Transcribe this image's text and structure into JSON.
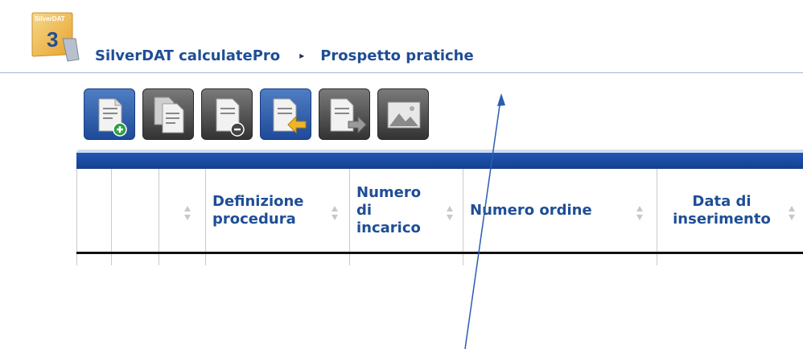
{
  "app": {
    "logo_text": "SilverDAT",
    "logo_number": "3"
  },
  "breadcrumb": {
    "app_name": "SilverDAT calculatePro",
    "separator": "▸",
    "page": "Prospetto pratiche"
  },
  "toolbar": {
    "buttons": [
      {
        "name": "new-document-icon",
        "color": "blue"
      },
      {
        "name": "copy-document-icon",
        "color": "dark"
      },
      {
        "name": "remove-document-icon",
        "color": "dark"
      },
      {
        "name": "import-document-icon",
        "color": "blue"
      },
      {
        "name": "export-document-icon",
        "color": "dark"
      },
      {
        "name": "image-icon",
        "color": "dark"
      }
    ]
  },
  "grid": {
    "columns": [
      {
        "label": ""
      },
      {
        "label": ""
      },
      {
        "label": ""
      },
      {
        "label": "Definizione procedura"
      },
      {
        "label": "Numero di incarico"
      },
      {
        "label": "Numero ordine"
      },
      {
        "label": "Data di inserimento"
      }
    ]
  },
  "colors": {
    "accent": "#1f4e96",
    "toolbar_blue": "#1e4a9a",
    "toolbar_dark": "#333333",
    "grid_bar": "#1f57b4"
  }
}
